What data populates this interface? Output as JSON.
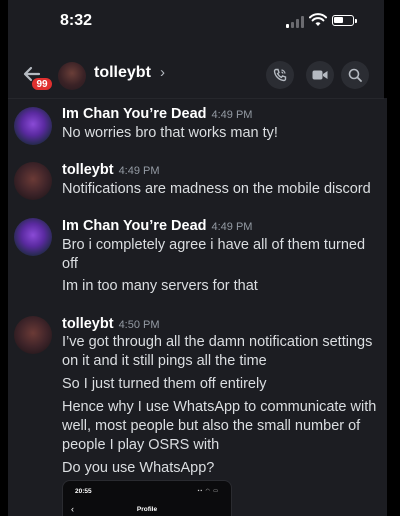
{
  "status_bar": {
    "time": "8:32"
  },
  "header": {
    "notification_count": "99",
    "channel_name": "tolleybt",
    "chevron": "›"
  },
  "icons": {
    "back": "arrow-left-icon",
    "call": "phone-call-icon",
    "video": "video-camera-icon",
    "search": "search-icon"
  },
  "messages": [
    {
      "author": "Im Chan You’re Dead",
      "time": "4:49 PM",
      "avatar": "chan",
      "lines": [
        "No worries bro that works man ty!"
      ]
    },
    {
      "author": "tolleybt",
      "time": "4:49 PM",
      "avatar": "tolley",
      "lines": [
        "Notifications are madness on the mobile discord"
      ]
    },
    {
      "author": "Im Chan You’re Dead",
      "time": "4:49 PM",
      "avatar": "chan",
      "lines": [
        "Bro i completely agree i have all of them turned off",
        "Im in too many servers for that"
      ]
    },
    {
      "author": "tolleybt",
      "time": "4:50 PM",
      "avatar": "tolley",
      "lines": [
        "I’ve got through all the damn notification settings on it and it still pings all the time",
        "So I just turned them off entirely",
        "Hence why I use WhatsApp to communicate with well, most people but also the small number of people I play OSRS with",
        "Do you use WhatsApp?"
      ]
    }
  ],
  "embed": {
    "time": "20:55",
    "back": "‹",
    "title": "Profile"
  },
  "colors": {
    "background": "#1c1d22",
    "badge": "#e0302f",
    "text": "#dbdee1",
    "timestamp": "#949ba4"
  }
}
